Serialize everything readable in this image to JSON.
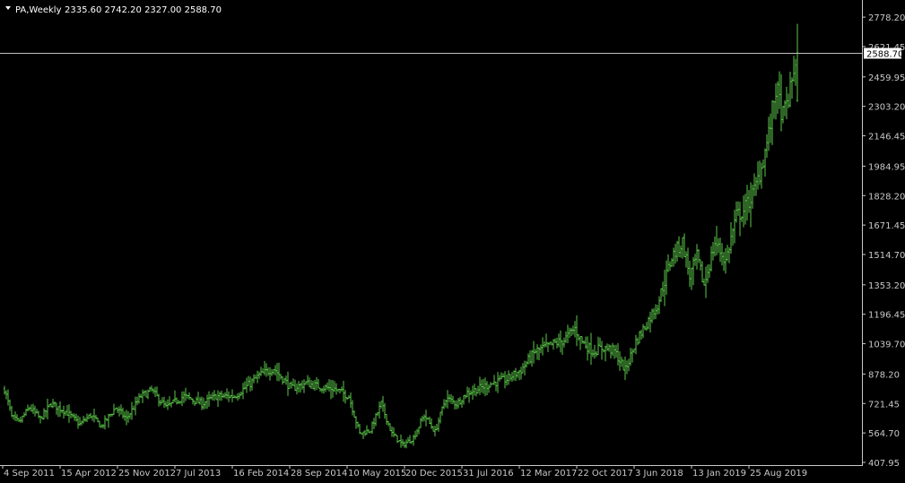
{
  "header": {
    "symbol": "PA,Weekly",
    "ohlc": "2335.60 2742.20 2327.00 2588.70",
    "arrow_icon": "triangle-down-icon"
  },
  "colors": {
    "background": "#000000",
    "bars": "#5cc84a",
    "axis": "#c8c8c8",
    "price_line": "#c0c0c0",
    "price_tag_bg": "#ffffff",
    "text": "#ffffff"
  },
  "current_price": {
    "value": 2588.7,
    "label": "2588.70"
  },
  "chart_data": {
    "type": "line",
    "style": "ohlc-bars",
    "timeframe": "Weekly",
    "symbol": "PA",
    "title": "",
    "xlabel": "",
    "ylabel": "",
    "grid": false,
    "ylim": [
      407.95,
      2855
    ],
    "y_ticks": [
      "2778.20",
      "2621.45",
      "2459.95",
      "2303.20",
      "2146.45",
      "1984.95",
      "1828.20",
      "1671.45",
      "1514.70",
      "1353.20",
      "1196.45",
      "1039.70",
      "878.20",
      "721.45",
      "564.70",
      "407.95"
    ],
    "x_ticks": [
      "4 Sep 2011",
      "15 Apr 2012",
      "25 Nov 2012",
      "7 Jul 2013",
      "16 Feb 2014",
      "28 Sep 2014",
      "10 May 2015",
      "20 Dec 2015",
      "31 Jul 2016",
      "12 Mar 2017",
      "22 Oct 2017",
      "3 Jun 2018",
      "13 Jan 2019",
      "25 Aug 2019"
    ],
    "x_tick_weeks": [
      0,
      32,
      64,
      96,
      128,
      160,
      192,
      224,
      256,
      288,
      320,
      352,
      384,
      416
    ],
    "path_weeks": [
      0,
      4,
      8,
      14,
      20,
      26,
      34,
      42,
      48,
      54,
      62,
      68,
      76,
      82,
      90,
      100,
      110,
      118,
      128,
      136,
      142,
      150,
      160,
      168,
      176,
      184,
      192,
      198,
      204,
      210,
      216,
      222,
      228,
      234,
      240,
      246,
      252,
      258,
      264,
      272,
      280,
      288,
      296,
      304,
      312,
      318,
      322,
      328,
      334,
      340,
      346,
      352,
      358,
      364,
      372,
      378,
      382,
      386,
      390,
      396,
      402,
      408,
      412,
      418,
      422,
      426,
      430,
      434,
      438,
      440,
      442
    ],
    "path_closes": [
      800,
      650,
      620,
      700,
      640,
      720,
      680,
      610,
      660,
      600,
      700,
      640,
      760,
      790,
      700,
      760,
      720,
      760,
      760,
      820,
      870,
      910,
      800,
      830,
      810,
      800,
      760,
      560,
      580,
      720,
      560,
      500,
      540,
      660,
      570,
      750,
      720,
      780,
      800,
      830,
      850,
      900,
      1000,
      1030,
      1060,
      1120,
      1050,
      1000,
      1020,
      1000,
      900,
      1050,
      1150,
      1250,
      1500,
      1580,
      1400,
      1500,
      1350,
      1580,
      1480,
      1720,
      1750,
      1850,
      1980,
      2150,
      2400,
      2250,
      2380,
      2500,
      2588.7
    ],
    "last_bar": {
      "open": 2335.6,
      "high": 2742.2,
      "low": 2327.0,
      "close": 2588.7
    }
  }
}
